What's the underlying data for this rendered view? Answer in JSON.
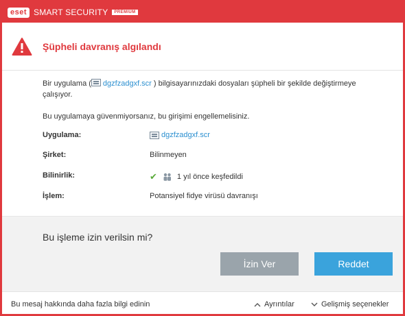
{
  "titlebar": {
    "logo": "eset",
    "product": "SMART SECURITY",
    "edition": "PREMIUM"
  },
  "header": {
    "icon": "warning-triangle-icon",
    "title": "Şüpheli davranış algılandı"
  },
  "message": {
    "p1_before": "Bir uygulama (",
    "p1_file": "dgzfzadgxf.scr",
    "p1_after": ") bilgisayarınızdaki dosyaları şüpheli bir şekilde değiştirmeye çalışıyor.",
    "p2": "Bu uygulamaya güvenmiyorsanız, bu girişimi engellemelisiniz."
  },
  "details": {
    "app_label": "Uygulama:",
    "app_value": "dgzfzadgxf.scr",
    "company_label": "Şirket:",
    "company_value": "Bilinmeyen",
    "reputation_label": "Bilinirlik:",
    "reputation_value": "1 yıl önce keşfedildi",
    "operation_label": "İşlem:",
    "operation_value": "Potansiyel fidye virüsü davranışı"
  },
  "question": "Bu işleme izin verilsin mi?",
  "buttons": {
    "allow": "İzin Ver",
    "deny": "Reddet"
  },
  "footer": {
    "info_link": "Bu mesaj hakkında daha fazla bilgi edinin",
    "details": "Ayrıntılar",
    "advanced": "Gelişmiş seçenekler"
  },
  "colors": {
    "accent_red": "#e0393e",
    "link_blue": "#2b8fd0",
    "deny_button": "#3aa3dc",
    "allow_button": "#9aa4ab",
    "check_green": "#5aaa3a"
  }
}
